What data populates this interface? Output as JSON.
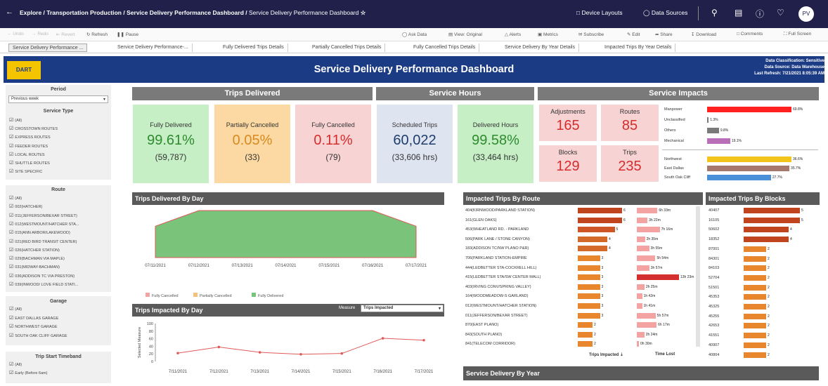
{
  "topbar": {
    "breadcrumb": [
      "Explore",
      "Transportation Production",
      "Service Delivery Performance Dashboard"
    ],
    "breadcrumb_last": "Service Delivery Performance Dashboard",
    "device_layouts": "Device Layouts",
    "data_sources": "Data Sources",
    "avatar": "PV"
  },
  "toolbar": {
    "undo": "Undo",
    "redo": "Redo",
    "revert": "Revert",
    "refresh": "Refresh",
    "pause": "Pause",
    "ask_data": "Ask Data",
    "view_original": "View: Original",
    "alerts": "Alerts",
    "metrics": "Metrics",
    "subscribe": "Subscribe",
    "edit": "Edit",
    "share": "Share",
    "download": "Download",
    "comments": "Comments",
    "full_screen": "Full Screen"
  },
  "tabs": [
    "Service Delivery Performance ...",
    "Service Delivery Performance-...",
    "Fully Delivered Trips Details",
    "Partially Cancelled Trips Details",
    "Fully Cancelled Trips Details",
    "Service Delivery By Year Details",
    "Impacted Trips By Year Details"
  ],
  "header": {
    "logo": "DART",
    "title": "Service Delivery Performance Dashboard",
    "classification": "Data Classification: Sensitive",
    "source": "Data Source: Data Warehouse",
    "refresh": "Last Refresh: 7/21/2021 8:05:39 AM"
  },
  "filters": {
    "period": {
      "title": "Period",
      "value": "Previous week"
    },
    "service_type": {
      "title": "Service Type",
      "items": [
        "(All)",
        "CROSSTOWN ROUTES",
        "EXPRESS ROUTES",
        "FEEDER ROUTES",
        "LOCAL ROUTES",
        "SHUTTLE ROUTES",
        "SITE SPECIFIC"
      ]
    },
    "route": {
      "title": "Route",
      "items": [
        "(All)",
        "002(HATCHER)",
        "011(JEFFERSON/BEXAR STREET)",
        "012(WESTMOUNT/HATCHER STA...",
        "015(ANN ARBOR/LAKEWOOD)",
        "021(RED BIRD TRANSIT CENTER)",
        "026(HATCHER STATION)",
        "029(BACHMAN VIA MAPLE)",
        "031(MIDWAY-BACHMAN)",
        "036(ADDISON TC VIA PRESTON)",
        "039(INWOOD/ LOVE FIELD STATI..."
      ]
    },
    "garage": {
      "title": "Garage",
      "items": [
        "(All)",
        "EAST DALLAS GARAGE",
        "NORTHWEST GARAGE",
        "SOUTH OAK CLIFF GARAGE"
      ]
    },
    "timeband": {
      "title": "Trip Start Timeband",
      "items": [
        "(All)",
        "Early (Before 6am)"
      ]
    }
  },
  "sections": {
    "trips_delivered": "Trips Delivered",
    "service_hours": "Service Hours",
    "service_impacts": "Service Impacts"
  },
  "kpis": [
    {
      "label": "Fully Delivered",
      "value": "99.61%",
      "sub": "(59,787)",
      "bg": "#c6efc6",
      "color": "#2e8b2e"
    },
    {
      "label": "Partially Cancelled",
      "value": "0.05%",
      "sub": "(33)",
      "bg": "#fcd9a2",
      "color": "#d98a1f"
    },
    {
      "label": "Fully Cancelled",
      "value": "0.11%",
      "sub": "(79)",
      "bg": "#f8d3d3",
      "color": "#d62c2c"
    },
    {
      "label": "Scheduled Trips",
      "value": "60,022",
      "sub": "(33,606 hrs)",
      "bg": "#dfe5f0",
      "color": "#1e3d6e"
    },
    {
      "label": "Delivered Hours",
      "value": "99.58%",
      "sub": "(33,464 hrs)",
      "bg": "#c6efc6",
      "color": "#2e8b2e"
    }
  ],
  "impacts": [
    {
      "label": "Adjustments",
      "value": "165"
    },
    {
      "label": "Routes",
      "value": "85"
    },
    {
      "label": "Blocks",
      "value": "129"
    },
    {
      "label": "Trips",
      "value": "235"
    }
  ],
  "impact_reasons": [
    {
      "label": "Manpower",
      "value": "69.8%",
      "pct": 69.8,
      "color": "#ff2020"
    },
    {
      "label": "Unclassified",
      "value": "1.3%",
      "pct": 1.3,
      "color": "#7a7a7a"
    },
    {
      "label": "Others",
      "value": "9.8%",
      "pct": 9.8,
      "color": "#7a7a7a"
    },
    {
      "label": "Mechanical",
      "value": "19.1%",
      "pct": 19.1,
      "color": "#b86fb8"
    }
  ],
  "impact_garages": [
    {
      "label": "Northwest",
      "value": "36.6%",
      "pct": 36.6,
      "color": "#f3c419"
    },
    {
      "label": "East Dallas",
      "value": "35.7%",
      "pct": 35.7,
      "color": "#a5786b"
    },
    {
      "label": "South Oak Cliff",
      "value": "27.7%",
      "pct": 27.7,
      "color": "#4a90d9"
    }
  ],
  "trips_by_day": {
    "title": "Trips Delivered By Day",
    "legend": [
      "Fully Cancelled",
      "Partially Cancelled",
      "Fully Delivered"
    ],
    "legend_colors": [
      "#f4a3a3",
      "#f6c17a",
      "#7ac37a"
    ]
  },
  "trips_impacted": {
    "title": "Trips Impacted By Day",
    "measure_label": "Measure",
    "measure_value": "Trips Impacted",
    "yaxis": "Selected Measure",
    "yticks": [
      "100",
      "80",
      "60",
      "40",
      "20",
      "0"
    ]
  },
  "chart_data": [
    {
      "type": "area",
      "title": "Trips Delivered By Day",
      "x": [
        "07/11/2021",
        "07/12/2021",
        "07/13/2021",
        "07/14/2021",
        "07/15/2021",
        "07/16/2021",
        "07/17/2021"
      ],
      "series": [
        {
          "name": "Fully Delivered",
          "values": [
            6400,
            9600,
            9600,
            9600,
            9600,
            9600,
            6400
          ]
        }
      ]
    },
    {
      "type": "line",
      "title": "Trips Impacted By Day",
      "x": [
        "7/11/2021",
        "7/12/2021",
        "7/13/2021",
        "7/14/2021",
        "7/15/2021",
        "7/16/2021",
        "7/17/2021"
      ],
      "ylabel": "Selected Measure",
      "ylim": [
        0,
        100
      ],
      "series": [
        {
          "name": "Trips Impacted",
          "values": [
            22,
            38,
            24,
            19,
            21,
            61,
            56
          ]
        }
      ]
    }
  ],
  "impacted_routes": {
    "title": "Impacted Trips By Route",
    "col_trips": "Trips Impacted",
    "col_time": "Time Lost",
    "rows": [
      {
        "route": "404(KIRNWOOD/PARKLAND STATION)",
        "trips": 6,
        "time": "6h 33m",
        "mins": 393
      },
      {
        "route": "161(GLEN OAKS)",
        "trips": 6,
        "time": "3h 22m",
        "mins": 202
      },
      {
        "route": "453(WHEATLAND RD. - PARKLAND",
        "trips": 5,
        "time": "7h 16m",
        "mins": 436
      },
      {
        "route": "506(PARK LANE / STONE CANYON)",
        "trips": 4,
        "time": "2h 35m",
        "mins": 155
      },
      {
        "route": "183(ADDISON TC/NW PLANO P&R)",
        "trips": 4,
        "time": "3h 55m",
        "mins": 235
      },
      {
        "route": "706(PARKLAND STATION-EMPIRE",
        "trips": 3,
        "time": "5h 54m",
        "mins": 354
      },
      {
        "route": "444(LEDBETTER STA-COCKRELL HILL)",
        "trips": 3,
        "time": "3h 57m",
        "mins": 237
      },
      {
        "route": "415(LEDBETTER STA/SW CENTER MALL)",
        "trips": 3,
        "time": "13h 23m",
        "mins": 803
      },
      {
        "route": "403(IRVING CONV/SPRING VALLEY)",
        "trips": 3,
        "time": "2h 25m",
        "mins": 145
      },
      {
        "route": "164(WOODMEADOW-S GARLAND)",
        "trips": 3,
        "time": "1h 42m",
        "mins": 102
      },
      {
        "route": "012(WESTMOUNT/HATCHER STATION)",
        "trips": 3,
        "time": "1h 41m",
        "mins": 101
      },
      {
        "route": "011(JEFFERSON/BEXAR STREET)",
        "trips": 3,
        "time": "5h 57m",
        "mins": 357
      },
      {
        "route": "870(EAST PLANO)",
        "trips": 2,
        "time": "6h 17m",
        "mins": 377
      },
      {
        "route": "843(SOUTH PLANO)",
        "trips": 2,
        "time": "2h 24m",
        "mins": 144
      },
      {
        "route": "841(TELECOM CORRIDOR)",
        "trips": 2,
        "time": "0h 30m",
        "mins": 30
      }
    ]
  },
  "impacted_blocks": {
    "title": "Impacted Trips By Blocks",
    "rows": [
      {
        "block": "40407",
        "trips": 5
      },
      {
        "block": "16105",
        "trips": 5
      },
      {
        "block": "50602",
        "trips": 4
      },
      {
        "block": "18352",
        "trips": 4
      },
      {
        "block": "87001",
        "trips": 2
      },
      {
        "block": "84301",
        "trips": 2
      },
      {
        "block": "84103",
        "trips": 2
      },
      {
        "block": "52704",
        "trips": 2
      },
      {
        "block": "51501",
        "trips": 2
      },
      {
        "block": "45353",
        "trips": 2
      },
      {
        "block": "45325",
        "trips": 2
      },
      {
        "block": "45255",
        "trips": 2
      },
      {
        "block": "42653",
        "trips": 2
      },
      {
        "block": "41551",
        "trips": 2
      },
      {
        "block": "40907",
        "trips": 2
      },
      {
        "block": "40804",
        "trips": 2
      }
    ]
  },
  "service_by_year": {
    "title": "Service Delivery By Year"
  }
}
